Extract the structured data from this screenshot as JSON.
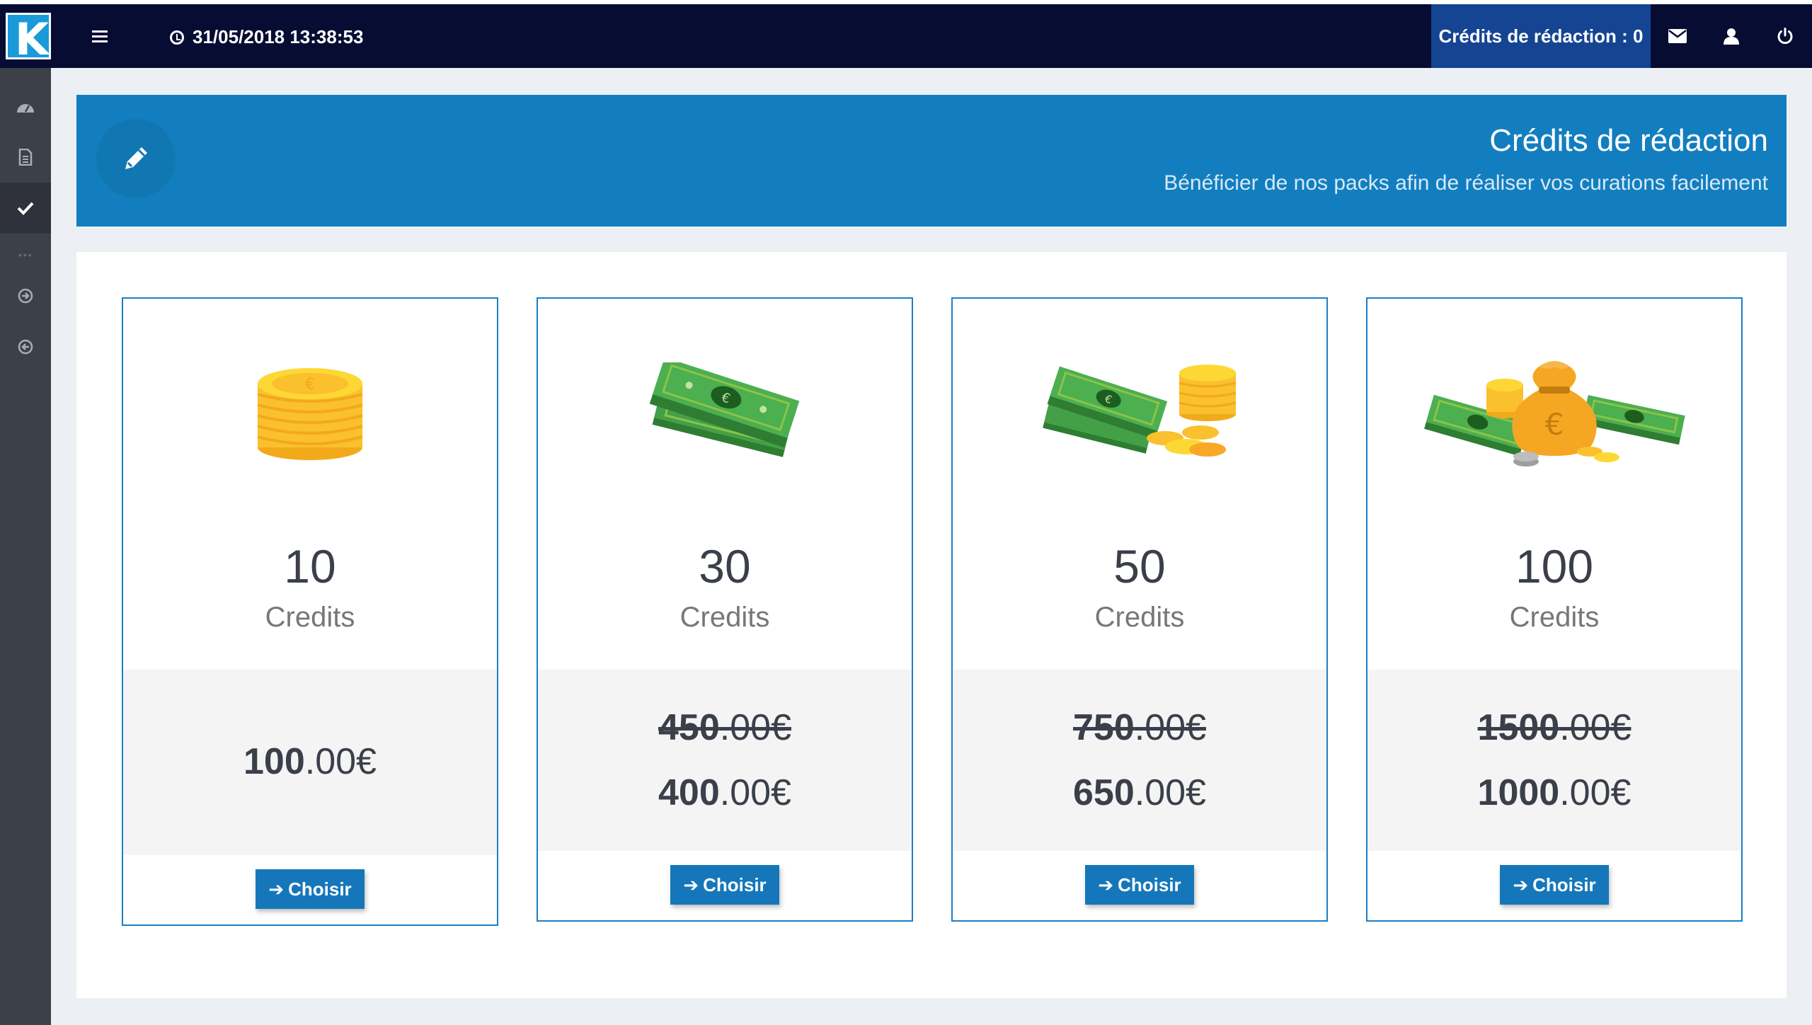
{
  "navbar": {
    "datetime": "31/05/2018 13:38:53",
    "credits_label": "Crédits de rédaction : 0"
  },
  "banner": {
    "title": "Crédits de rédaction",
    "subtitle": "Bénéficier de nos packs afin de réaliser vos curations facilement"
  },
  "cards": [
    {
      "amount": "10",
      "unit": "Credits",
      "old_int": "",
      "old_dec": "",
      "new_int": "100",
      "new_dec": ".00€",
      "button": "Choisir"
    },
    {
      "amount": "30",
      "unit": "Credits",
      "old_int": "450",
      "old_dec": ".00€",
      "new_int": "400",
      "new_dec": ".00€",
      "button": "Choisir"
    },
    {
      "amount": "50",
      "unit": "Credits",
      "old_int": "750",
      "old_dec": ".00€",
      "new_int": "650",
      "new_dec": ".00€",
      "button": "Choisir"
    },
    {
      "amount": "100",
      "unit": "Credits",
      "old_int": "1500",
      "old_dec": ".00€",
      "new_int": "1000",
      "new_dec": ".00€",
      "button": "Choisir"
    }
  ],
  "icons": {
    "sidebar": [
      "dashboard-icon",
      "document-icon",
      "check-icon",
      "arrow-circle-right-icon",
      "arrow-circle-left-icon"
    ],
    "navbar": [
      "menu-icon",
      "clock-icon",
      "mail-icon",
      "user-icon",
      "power-icon"
    ]
  },
  "colors": {
    "navbar": "#070c33",
    "credits_box": "#154492",
    "banner": "#137ebf",
    "button": "#1577ba",
    "card_border": "#1a80c4"
  }
}
